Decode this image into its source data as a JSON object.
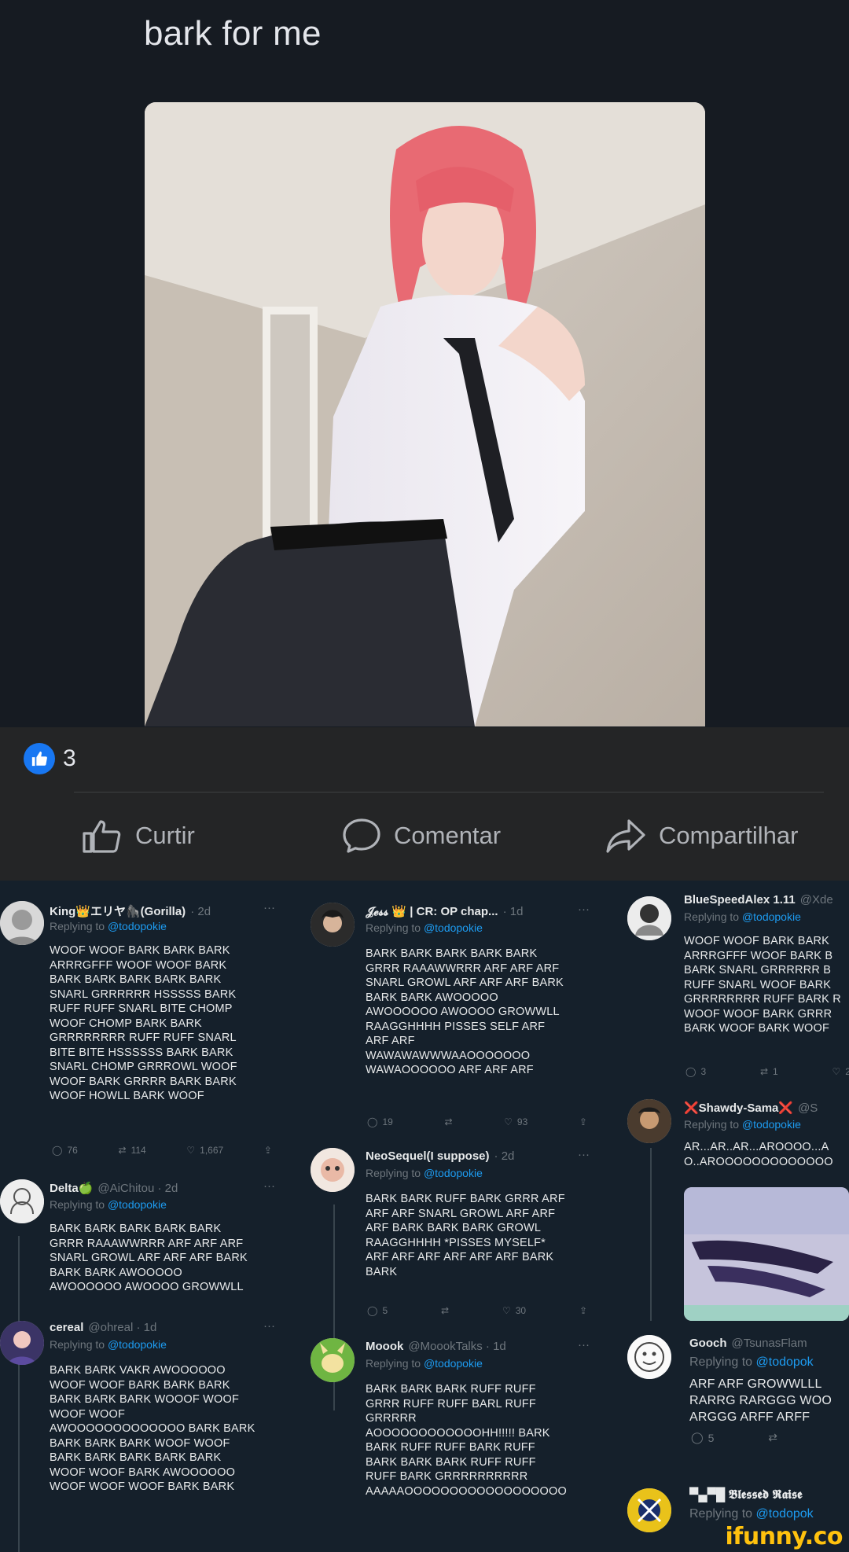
{
  "post": {
    "title": "bark for me",
    "photo_alt": "cosplay-photo",
    "like_count": "3",
    "actions": {
      "like": "Curtir",
      "comment": "Comentar",
      "share": "Compartilhar"
    }
  },
  "tweets": {
    "col1": [
      {
        "name": "King👑エリヤ🦍(Gorilla)",
        "handle": "· 2d",
        "reply_prefix": "Replying to ",
        "reply_to": "@todopokie",
        "body": "WOOF WOOF BARK BARK BARK\nARRRGFFF WOOF WOOF BARK\nBARK BARK BARK BARK BARK\nSNARL GRRRRRR HSSSSS BARK\nRUFF RUFF SNARL BITE CHOMP\nWOOF CHOMP BARK BARK\nGRRRRRRRR RUFF RUFF SNARL\nBITE BITE HSSSSSS BARK BARK\nSNARL CHOMP gRRROWL WOOF\nWOOF BARK GRRRR BARK BARK\nWOOF HOWLL BARK WOOF",
        "stats": [
          "76",
          "114",
          "1,667",
          ""
        ]
      },
      {
        "name": "Delta🍏",
        "handle": "@AiChitou · 2d",
        "reply_prefix": "Replying to ",
        "reply_to": "@todopokie",
        "body": "BARK BARK BARK BARK BARK\nGRRR RAAAWWRRR ARF ARF ARF\nSNARL GROWL ARF ARF ARF BARK\nBARK BARK AWOOOOO\nAWOOOOOO AWOOOO GROWWLL",
        "stats": []
      },
      {
        "name": "cereal",
        "handle": "@ohreal · 1d",
        "reply_prefix": "Replying to ",
        "reply_to": "@todopokie",
        "body": "BARK BARK VAKR AWOOOOOO\nWOOF WOOF BARK BARK BARK\nBARK BARK BARK WOOOF WOOF\nWOOF WOOF\nAWOOOOOOOOOOOOO BARK BARK\nBARK BARK BARK WOOF WOOF\nBARK BARK BARK BARK BARK\nWOOF WOOF BARK AWOOOOOO\nWOOF WOOF WOOF BARK BARK",
        "stats": []
      }
    ],
    "col2": [
      {
        "name": "𝓙𝓮𝓼𝓼 👑 | CR: OP chap...",
        "handle": "· 1d",
        "reply_prefix": "Replying to ",
        "reply_to": "@todopokie",
        "body": "BARK BARK BARK BARK BARK\nGRRR RAAAWWRRR ARF ARF ARF\nSNARL GROWL ARF ARF ARF BARK\nBARK BARK AWOOOOO\nAWOOOOOO AWOOOO GROWWLL\nRAAGGHHHH PISSES SELF ARF\nARF ARF\nWAWAWAWWWAAOOOOOOO\nWAWAOOOOOO ARF ARF ARF",
        "stats": [
          "19",
          "",
          "93",
          ""
        ]
      },
      {
        "name": "NeoSequel(I suppose)",
        "handle": "· 2d",
        "reply_prefix": "Replying to ",
        "reply_to": "@todopokie",
        "body": "BARK BARK RUFF BARK GRRR ARF\nARF ARF SNARL GROWL ARF ARF\nARF BARK BARK BARK GROWL\nRAAGGHHHH *PISSES MYSELF*\nARF ARF ARF ARF ARF ARF BARK\nBARK",
        "stats": [
          "5",
          "",
          "30",
          ""
        ]
      },
      {
        "name": "Moook",
        "handle": "@MoookTalks · 1d",
        "reply_prefix": "Replying to ",
        "reply_to": "@todopokie",
        "body": "BARK BARK BARK RUFF RUFF\nGRRR RUFF RUFF BARL RUFF\nGRRRRR\nAOOOOOOOOOOOOHH!!!!! BARK\nBARK RUFF RUFF BARK RUFF\nBARK BARK BARK RUFF RUFF\nRUFF BARK GRRRRRRRRRR\nAAAAAOOOOOOOOOOOOOOOOOO",
        "stats": []
      }
    ],
    "col3": [
      {
        "name": "BlueSpeedAlex 1.11",
        "handle": "@Xde",
        "reply_prefix": "Replying to ",
        "reply_to": "@todopokie",
        "body": "WOOF WOOF BARK BARK\nARRRGFFF WOOF BARK B\nBARK SNARL GRRRRRR B\nRUFF SNARL WOOF BARK\nGRRRRRRRR RUFF BARK R\nWOOF WOOF BARK GRRR\nBARK WOOF BARK WOOF",
        "stats": [
          "3",
          "1",
          "2"
        ]
      },
      {
        "name": "❌Shawdy-Sama❌",
        "handle": "@S",
        "reply_prefix": "Replying to ",
        "reply_to": "@todopokie",
        "body": "AR...AR..AR...AROOOO...A\nO..AROOOOOOOOOOOOO",
        "stats": []
      },
      {
        "name": "Gooch",
        "handle": "@TsunasFlam",
        "reply_prefix": "Replying to ",
        "reply_to": "@todopok",
        "body": "ARF ARF GROWWLLL\nRARRG RARGGG WOO\nARGGG ARFF ARFF",
        "stats": [
          "5",
          ""
        ]
      },
      {
        "name": "▀▄▀█ 𝕭𝖑𝖊𝖘𝖘𝖊𝖉 𝕽𝖆𝖎𝖘𝖊",
        "handle": "",
        "reply_prefix": "Replying to ",
        "reply_to": "@todopok",
        "body": "",
        "stats": []
      }
    ]
  },
  "watermark": "ifunny.co",
  "colors": {
    "facebook_blue": "#1877f2",
    "twitter_bg": "#15202b",
    "mention_blue": "#1d9bf0",
    "watermark_yellow": "#ffc20e"
  }
}
